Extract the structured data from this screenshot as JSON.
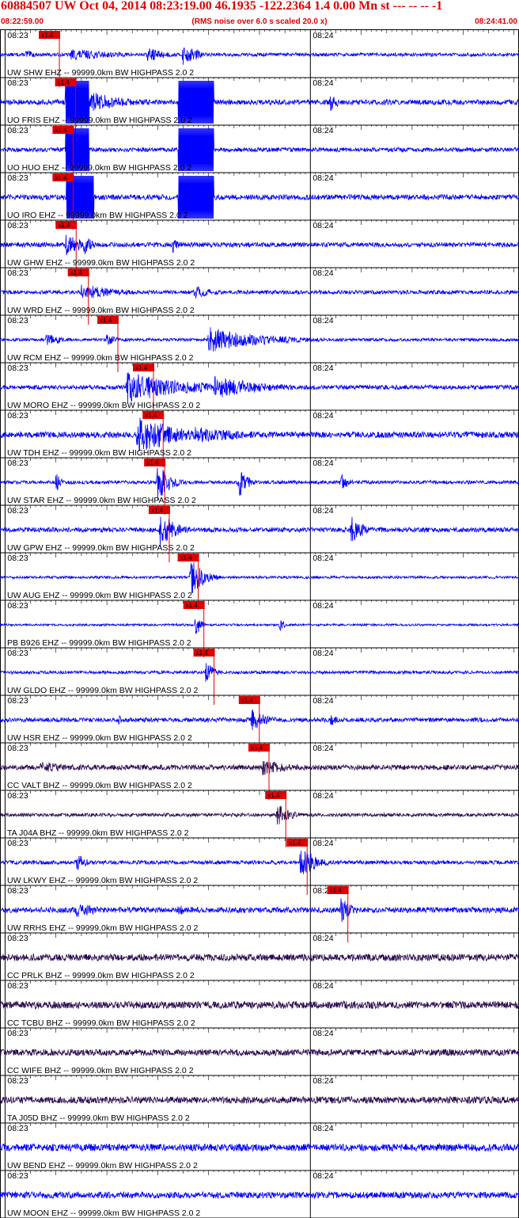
{
  "header": {
    "title": "60884507 UW Oct 04, 2014 08:23:19.00   46.1935 -122.2364  1.4 0.00 Mn st --- -- --  -1",
    "start_time": "08:22:59.00",
    "noise_note": "(RMS noise over 6.0 s scaled 20.0 x)",
    "end_time": "08:24:41.00"
  },
  "colors": {
    "title": "#e00000",
    "trace_blue": "#0000ff",
    "trace_dark": "#2a0a50",
    "pick": "#e00000",
    "grid": "#000000"
  },
  "chart_data": {
    "type": "line",
    "x_unit": "time (UTC)",
    "x_range": [
      "08:22:59.00",
      "08:24:41.00"
    ],
    "tick_labels": [
      "08:23",
      "08:24"
    ],
    "tick_times_s": [
      1,
      61
    ],
    "window_s": 102,
    "pick_label": "x1.4",
    "series": [
      {
        "name": "UW SHW EHZ -- 99999.0km BW  HIGHPASS  2.0  2",
        "color": "blue",
        "pick_s": 9.8,
        "bursts": [
          [
            5.1,
            1.8,
            0.25
          ],
          [
            14.0,
            10.0,
            0.28
          ],
          [
            29.0,
            4.0,
            0.35
          ],
          [
            36.0,
            2.5,
            0.55
          ],
          [
            38.5,
            1.5,
            0.3
          ]
        ],
        "noise": 0.08
      },
      {
        "name": "UO FRIS EHZ -- 99999.0km BW  HIGHPASS  2.0  2",
        "color": "blue",
        "pick_s": 13.0,
        "bursts": [
          [
            13.0,
            7.0,
            1.0
          ],
          [
            65.0,
            2.0,
            0.45
          ],
          [
            37.0,
            2.0,
            0.15
          ]
        ],
        "blocks": [
          [
            12.9,
            17.5
          ],
          [
            35.0,
            42.0
          ]
        ],
        "noise": 0.12
      },
      {
        "name": "UO HUO EHZ -- 99999.0km BW  HIGHPASS  2.0  2",
        "color": "blue",
        "pick_s": 12.5,
        "bursts": [
          [
            14.0,
            3.0,
            0.3
          ]
        ],
        "blocks": [
          [
            12.9,
            17.5
          ],
          [
            35.0,
            42.0
          ]
        ],
        "noise": 0.1
      },
      {
        "name": "UO IRO EHZ -- 99999.0km BW  HIGHPASS  2.0  2",
        "color": "blue",
        "pick_s": 12.5,
        "bursts": [
          [
            14.0,
            3.0,
            0.3
          ]
        ],
        "blocks": [
          [
            13.0,
            18.5
          ],
          [
            35.0,
            42.0
          ]
        ],
        "noise": 0.12
      },
      {
        "name": "UW GHW EHZ -- 99999.0km BW  HIGHPASS  2.0  2",
        "color": "blue",
        "pick_s": 13.1,
        "bursts": [
          [
            13.0,
            4.0,
            0.5
          ],
          [
            16.5,
            1.5,
            0.55
          ],
          [
            34.0,
            1.5,
            0.4
          ]
        ],
        "noise": 0.11
      },
      {
        "name": "UW WRD EHZ -- 99999.0km BW  HIGHPASS  2.0  2",
        "color": "blue",
        "pick_s": 15.5,
        "bursts": [
          [
            16.0,
            2.0,
            0.45
          ],
          [
            18.0,
            6.0,
            0.32
          ],
          [
            38.0,
            4.0,
            0.35
          ]
        ],
        "noise": 0.09
      },
      {
        "name": "UW RCM EHZ -- 99999.0km BW  HIGHPASS  2.0  2",
        "color": "blue",
        "pick_s": 21.3,
        "bursts": [
          [
            9.0,
            3.0,
            0.35
          ],
          [
            21.0,
            2.0,
            0.3
          ],
          [
            41.0,
            11.0,
            0.6
          ]
        ],
        "noise": 0.07
      },
      {
        "name": "UW MORO EHZ -- 99999.0km BW  HIGHPASS  2.0  2",
        "color": "blue",
        "pick_s": 28.3,
        "bursts": [
          [
            25.0,
            12.0,
            0.75
          ],
          [
            42.0,
            10.0,
            0.55
          ]
        ],
        "noise": 0.1
      },
      {
        "name": "UW TDH EHZ -- 99999.0km BW  HIGHPASS  2.0  2",
        "color": "blue",
        "pick_s": 30.2,
        "bursts": [
          [
            27.0,
            8.0,
            0.9
          ],
          [
            31.0,
            4.0,
            0.7
          ],
          [
            38.0,
            12.0,
            0.4
          ]
        ],
        "noise": 0.14
      },
      {
        "name": "UW STAR EHZ -- 99999.0km BW  HIGHPASS  2.0  2",
        "color": "blue",
        "pick_s": 30.5,
        "bursts": [
          [
            11.0,
            1.0,
            0.5
          ],
          [
            31.0,
            2.5,
            0.9
          ],
          [
            47.0,
            1.5,
            0.85
          ],
          [
            67.0,
            1.5,
            0.45
          ]
        ],
        "noise": 0.08
      },
      {
        "name": "UW GPW EHZ -- 99999.0km BW  HIGHPASS  2.0  2",
        "color": "blue",
        "pick_s": 31.4,
        "bursts": [
          [
            31.5,
            3.0,
            0.9
          ],
          [
            69.0,
            2.5,
            0.7
          ]
        ],
        "noise": 0.11
      },
      {
        "name": "UW AUG EHZ -- 99999.0km BW  HIGHPASS  2.0  2",
        "color": "blue",
        "pick_s": 37.1,
        "bursts": [
          [
            37.5,
            2.5,
            0.9
          ]
        ],
        "noise": 0.06
      },
      {
        "name": "PB B926 EHZ -- 99999.0km BW  HIGHPASS  2.0  2",
        "color": "blue",
        "pick_s": 38.2,
        "bursts": [
          [
            38.5,
            1.0,
            0.6
          ],
          [
            55.0,
            1.0,
            0.3
          ]
        ],
        "noise": 0.05
      },
      {
        "name": "UW GLDO EHZ -- 99999.0km BW  HIGHPASS  2.0  2",
        "color": "blue",
        "pick_s": 40.2,
        "bursts": [
          [
            40.5,
            1.5,
            0.6
          ]
        ],
        "noise": 0.07
      },
      {
        "name": "UW HSR EHZ -- 99999.0km BW  HIGHPASS  2.0  2",
        "color": "blue",
        "pick_s": 49.1,
        "bursts": [
          [
            49.5,
            3.0,
            0.55
          ],
          [
            23.0,
            2.0,
            0.25
          ],
          [
            65.0,
            2.0,
            0.3
          ]
        ],
        "noise": 0.1
      },
      {
        "name": "CC VALT BHZ -- 99999.0km BW  HIGHPASS  2.0  2",
        "color": "dark",
        "pick_s": 51.0,
        "bursts": [
          [
            51.5,
            6.0,
            0.4
          ],
          [
            8.0,
            8.0,
            0.28
          ]
        ],
        "noise": 0.12
      },
      {
        "name": "TA J04A BHZ -- 99999.0km BW  HIGHPASS  2.0  2",
        "color": "dark",
        "pick_s": 54.3,
        "bursts": [
          [
            54.5,
            2.5,
            0.55
          ]
        ],
        "noise": 0.08
      },
      {
        "name": "UW LKWY EHZ -- 99999.0km BW  HIGHPASS  2.0  2",
        "color": "blue",
        "pick_s": 58.5,
        "bursts": [
          [
            15.0,
            2.5,
            0.4
          ],
          [
            59.0,
            3.0,
            0.85
          ]
        ],
        "noise": 0.09
      },
      {
        "name": "UW RRHS EHZ -- 99999.0km BW  HIGHPASS  2.0  2",
        "color": "blue",
        "pick_s": 66.5,
        "bursts": [
          [
            15.0,
            5.0,
            0.4
          ],
          [
            67.0,
            2.0,
            0.7
          ],
          [
            35.0,
            5.0,
            0.25
          ]
        ],
        "noise": 0.13
      },
      {
        "name": "CC PRLK BHZ -- 99999.0km BW  HIGHPASS  2.0  2",
        "color": "dark",
        "pick_s": null,
        "bursts": [],
        "noise": 0.16
      },
      {
        "name": "CC TCBU BHZ -- 99999.0km BW  HIGHPASS  2.0  2",
        "color": "dark",
        "pick_s": null,
        "bursts": [],
        "noise": 0.17
      },
      {
        "name": "CC WIFE BHZ -- 99999.0km BW  HIGHPASS  2.0  2",
        "color": "dark",
        "pick_s": null,
        "bursts": [],
        "noise": 0.15
      },
      {
        "name": "TA J05D BHZ -- 99999.0km BW  HIGHPASS  2.0  2",
        "color": "dark",
        "pick_s": null,
        "bursts": [],
        "noise": 0.16
      },
      {
        "name": "UW BEND EHZ -- 99999.0km BW  HIGHPASS  2.0  2",
        "color": "blue",
        "pick_s": null,
        "bursts": [],
        "noise": 0.17
      },
      {
        "name": "UW MOON EHZ -- 99999.0km BW  HIGHPASS  2.0  2",
        "color": "blue",
        "pick_s": null,
        "bursts": [],
        "noise": 0.15
      }
    ]
  }
}
